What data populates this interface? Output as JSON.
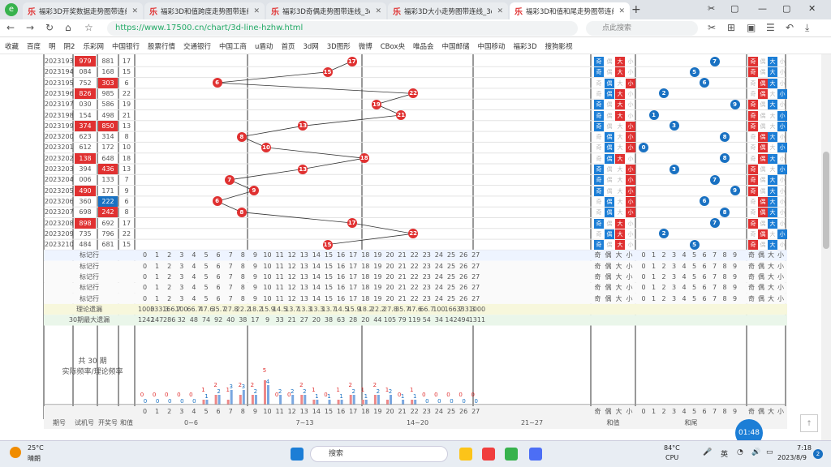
{
  "browser": {
    "tabs": [
      {
        "title": "福彩3D开奖数据走势图带连线"
      },
      {
        "title": "福彩3D和值跨度走势图带连线"
      },
      {
        "title": "福彩3D奇偶走势图带连线_3d..."
      },
      {
        "title": "福彩3D大小走势图带连线_3d..."
      },
      {
        "title": "福彩3D和值和尾走势图带连线"
      }
    ],
    "url": "https://www.17500.cn/chart/3d-line-hzhw.html",
    "search_placeholder": "点此搜索",
    "bookmarks": [
      "收藏",
      "百度",
      "明",
      "阴2",
      "乐彩网",
      "中国银行",
      "股票行情",
      "交通银行",
      "中国工商",
      "u盾动",
      "首页",
      "3d网",
      "3D图形",
      "微博",
      "CBox央",
      "唯品会",
      "中国邮储",
      "中国移动",
      "福彩3D",
      "搜狗影视"
    ]
  },
  "table": {
    "rows": [
      {
        "issue": "2023193",
        "test": "979",
        "prize": "881",
        "sum": "17",
        "sum_hi": true
      },
      {
        "issue": "2023194",
        "test": "084",
        "prize": "168",
        "sum": "15",
        "sum_hi": false
      },
      {
        "issue": "2023195",
        "test": "752",
        "prize": "303",
        "sum": "6",
        "sum_hi": true
      },
      {
        "issue": "2023196",
        "test": "826",
        "prize": "985",
        "sum": "22",
        "sum_hi": false
      },
      {
        "issue": "2023197",
        "test": "030",
        "prize": "586",
        "sum": "19",
        "sum_hi": true
      },
      {
        "issue": "2023198",
        "test": "154",
        "prize": "498",
        "sum": "21",
        "sum_hi": false
      },
      {
        "issue": "2023199",
        "test": "374",
        "prize": "850",
        "sum": "13",
        "sum_hi": false
      },
      {
        "issue": "2023200",
        "test": "623",
        "prize": "314",
        "sum": "8",
        "sum_hi": false
      },
      {
        "issue": "2023201",
        "test": "612",
        "prize": "172",
        "sum": "10",
        "sum_hi": false
      },
      {
        "issue": "2023202",
        "test": "138",
        "prize": "648",
        "sum": "18",
        "sum_hi": false
      },
      {
        "issue": "2023203",
        "test": "394",
        "prize": "436",
        "sum": "13",
        "sum_hi": false
      },
      {
        "issue": "2023204",
        "test": "006",
        "prize": "133",
        "sum": "7",
        "sum_hi": true
      },
      {
        "issue": "2023205",
        "test": "490",
        "prize": "171",
        "sum": "9",
        "sum_hi": true
      },
      {
        "issue": "2023206",
        "test": "360",
        "prize": "222",
        "sum": "6",
        "sum_hi": true
      },
      {
        "issue": "2023207",
        "test": "698",
        "prize": "242",
        "sum": "8",
        "sum_hi": true
      },
      {
        "issue": "2023208",
        "test": "898",
        "prize": "692",
        "sum": "17",
        "sum_hi": true
      },
      {
        "issue": "2023209",
        "test": "735",
        "prize": "796",
        "sum": "22",
        "sum_hi": false
      },
      {
        "issue": "2023210",
        "test": "484",
        "prize": "681",
        "sum": "15",
        "sum_hi": true
      }
    ],
    "mark_labels": [
      "标记行",
      "标记行",
      "标记行",
      "标记行",
      "标记行"
    ],
    "theory_label": "理论遗漏",
    "max_label": "30期最大遗漏",
    "summary_label_1": "共 30 期",
    "summary_label_2": "实际频率/理论频率",
    "digits": [
      "0",
      "1",
      "2",
      "3",
      "4",
      "5",
      "6",
      "7",
      "8",
      "9",
      "10",
      "11",
      "12",
      "13",
      "14",
      "15",
      "16",
      "17",
      "18",
      "19",
      "20",
      "21",
      "22",
      "23",
      "24",
      "25",
      "26",
      "27"
    ],
    "parity_labels": [
      "奇",
      "偶",
      "大",
      "小"
    ],
    "tail_digits": [
      "0",
      "1",
      "2",
      "3",
      "4",
      "5",
      "6",
      "7",
      "8",
      "9"
    ],
    "theory_values": [
      "1000",
      "333.3",
      "166.7",
      "100",
      "66.7",
      "47.6",
      "35.7",
      "27.8",
      "22.2",
      "18.2",
      "15.9",
      "14.5",
      "13.7",
      "13.3",
      "13.3",
      "13.7",
      "14.5",
      "15.9",
      "18.2",
      "22.2",
      "27.8",
      "35.7",
      "47.6",
      "66.7",
      "100",
      "166.7",
      "333.3",
      "1000"
    ],
    "max_values": [
      "1242",
      "147",
      "286",
      "32",
      "48",
      "74",
      "92",
      "40",
      "38",
      "17",
      "9",
      "33",
      "21",
      "27",
      "20",
      "38",
      "63",
      "28",
      "20",
      "44",
      "105",
      "79",
      "119",
      "54",
      "34",
      "142",
      "494",
      "1311"
    ],
    "footer_headers": [
      "期号",
      "试机号",
      "开奖号",
      "和值"
    ],
    "group_labels": [
      "0~6",
      "7~13",
      "14~20",
      "21~27",
      "和值",
      "和尾"
    ]
  },
  "chart_data": {
    "type": "bar",
    "title": "",
    "categories": [
      "0",
      "1",
      "2",
      "3",
      "4",
      "5",
      "6",
      "7",
      "8",
      "9",
      "10",
      "11",
      "12",
      "13",
      "14",
      "15",
      "16",
      "17",
      "18",
      "19",
      "20",
      "21",
      "22",
      "23",
      "24",
      "25",
      "26",
      "27"
    ],
    "series": [
      {
        "values": [
          0,
          0,
          0,
          0,
          0,
          1,
          2,
          1,
          2,
          2,
          5,
          0,
          0,
          2,
          1,
          0,
          1,
          2,
          1,
          2,
          1,
          0,
          1,
          0,
          0,
          0,
          0,
          0
        ]
      },
      {
        "values": [
          0,
          0,
          0,
          0,
          0,
          1,
          2,
          3,
          3,
          2,
          4,
          2,
          2,
          2,
          1,
          1,
          1,
          2,
          1,
          2,
          2,
          1,
          1,
          0,
          0,
          0,
          0,
          0
        ]
      }
    ]
  },
  "widget": {
    "time": "01:48"
  },
  "taskbar": {
    "weather_temp": "25°C",
    "weather_desc": "晴朗",
    "search": "搜索",
    "cpu_temp": "84°C",
    "cpu_label": "CPU",
    "lang": "英",
    "time": "7:18",
    "date": "2023/8/9",
    "notif": "2"
  }
}
